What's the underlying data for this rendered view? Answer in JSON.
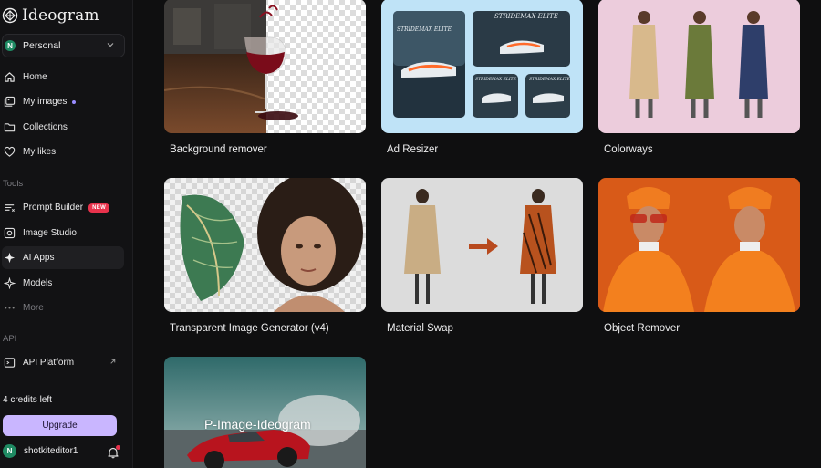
{
  "app": {
    "name": "Ideogram"
  },
  "workspace": {
    "initial": "N",
    "name": "Personal"
  },
  "nav": {
    "primary": [
      {
        "id": "home",
        "label": "Home",
        "icon": "home-icon"
      },
      {
        "id": "my-images",
        "label": "My images",
        "icon": "images-icon",
        "indicator": true
      },
      {
        "id": "collections",
        "label": "Collections",
        "icon": "folder-icon"
      },
      {
        "id": "my-likes",
        "label": "My likes",
        "icon": "heart-icon"
      }
    ],
    "tools_label": "Tools",
    "tools": [
      {
        "id": "prompt-builder",
        "label": "Prompt Builder",
        "icon": "sliders-icon",
        "badge": "NEW"
      },
      {
        "id": "image-studio",
        "label": "Image Studio",
        "icon": "studio-icon"
      },
      {
        "id": "ai-apps",
        "label": "AI Apps",
        "icon": "apps-icon",
        "active": true
      },
      {
        "id": "models",
        "label": "Models",
        "icon": "models-icon"
      },
      {
        "id": "more",
        "label": "More",
        "icon": "ellipsis-icon"
      }
    ],
    "api_label": "API",
    "api": [
      {
        "id": "api-platform",
        "label": "API Platform",
        "icon": "terminal-icon",
        "external": true
      }
    ]
  },
  "account": {
    "credits": "4 credits left",
    "upgrade_label": "Upgrade",
    "user_initial": "N",
    "username": "shotkiteditor1"
  },
  "apps": [
    {
      "title": "Background remover"
    },
    {
      "title": "Ad Resizer",
      "thumb_text": "STRIDEMAX ELITE"
    },
    {
      "title": "Colorways"
    },
    {
      "title": "Transparent Image Generator (v4)"
    },
    {
      "title": "Material Swap"
    },
    {
      "title": "Object Remover"
    },
    {
      "title": "",
      "thumb_text": "P-Image-Ideogram"
    }
  ],
  "colors": {
    "accent": "#c9b6ff",
    "new_badge": "#e8324c",
    "avatar": "#1f8a63",
    "background": "#0f0f10"
  }
}
